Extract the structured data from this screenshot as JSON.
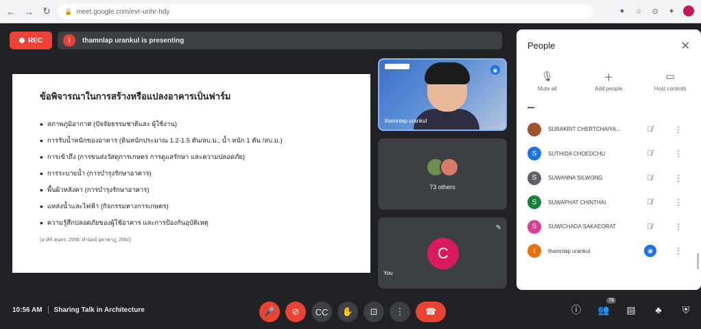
{
  "browser": {
    "url": "meet.google.com/evr-unhr-hdy",
    "nav": {
      "back": "←",
      "forward": "→",
      "reload": "↻"
    },
    "extensions": [
      "●",
      "☆",
      "⊙",
      "✦"
    ]
  },
  "meet": {
    "rec_label": "REC",
    "presenting_text": "thamnlap urankul is presenting",
    "presenting_icon": "!",
    "colors": {
      "rec": "#ea4335",
      "accent": "#1a73e8",
      "you_avatar": "#d81b60"
    }
  },
  "slide": {
    "title": "ข้อพิจารณาในการสร้างหรือแปลงอาคารเป็นฟาร์ม",
    "bullets": [
      "สภาพภูมิอากาศ (ปัจจัยธรรมชาติและ ผู้ใช้งาน)",
      "การรับน้ำหนักของอาคาร (ดินหนักประมาณ 1.2-1.5 ตัน/ลบ.ม., น้ำ หนัก 1 ตัน /ลบ.ม.)",
      "การเข้าถึง (การขนส่งวัสดุการเกษตร การดูแลรักษา และความปลอดภัย)",
      "การระบายน้ำ (การบำรุงรักษาอาคาร)",
      "พื้นผิวหลังคา (การบำรุงรักษาอาคาร)",
      "แหล่งน้ำและไฟฟ้า (กิจกรรมทางการเกษตร)",
      "ความรู้สึกปลอดภัยของผู้ใช้อาคาร และการป้องกันอุบัติเหตุ"
    ],
    "source": "(อาศิร์ สุนทร, 2556; ทำนิตย์ อุดาพาฎ, 2560)"
  },
  "tiles": {
    "speaker_name": "thamnlap urankul",
    "others_label": "73 others",
    "you_label": "You",
    "you_initial": "C"
  },
  "people": {
    "title": "People",
    "close": "✕",
    "actions": [
      {
        "icon": "🎙",
        "label": "Mute all"
      },
      {
        "icon": "＋",
        "label": "Add people"
      },
      {
        "icon": "▭",
        "label": "Host controls"
      }
    ],
    "list": [
      {
        "name": "SURAKRIT CHERTCHAIYA...",
        "initial": "",
        "color": "#a0522d",
        "mic": "muted"
      },
      {
        "name": "SUTHIDA CHOEDCHU",
        "initial": "S",
        "color": "#1a73e8",
        "mic": "muted"
      },
      {
        "name": "SUWANNA SILWONG",
        "initial": "S",
        "color": "#5f6368",
        "mic": "muted"
      },
      {
        "name": "SUWAPHAT CHINTHAI",
        "initial": "S",
        "color": "#188038",
        "mic": "muted"
      },
      {
        "name": "SUWICHADA SAKAEORAT",
        "initial": "S",
        "color": "#d93f8f",
        "mic": "muted"
      },
      {
        "name": "thamnlap urankul",
        "initial": "t",
        "color": "#e8710a",
        "mic": "active"
      }
    ]
  },
  "bottom": {
    "time": "10:56 AM",
    "meeting_name": "Sharing Talk in Architecture",
    "controls": [
      "🎤",
      "⊘",
      "CC",
      "✋",
      "⊡",
      "⋮",
      "☎"
    ],
    "right_icons": [
      "ⓘ",
      "👥",
      "▤",
      "♣",
      "⛨"
    ],
    "participant_count": "78"
  }
}
